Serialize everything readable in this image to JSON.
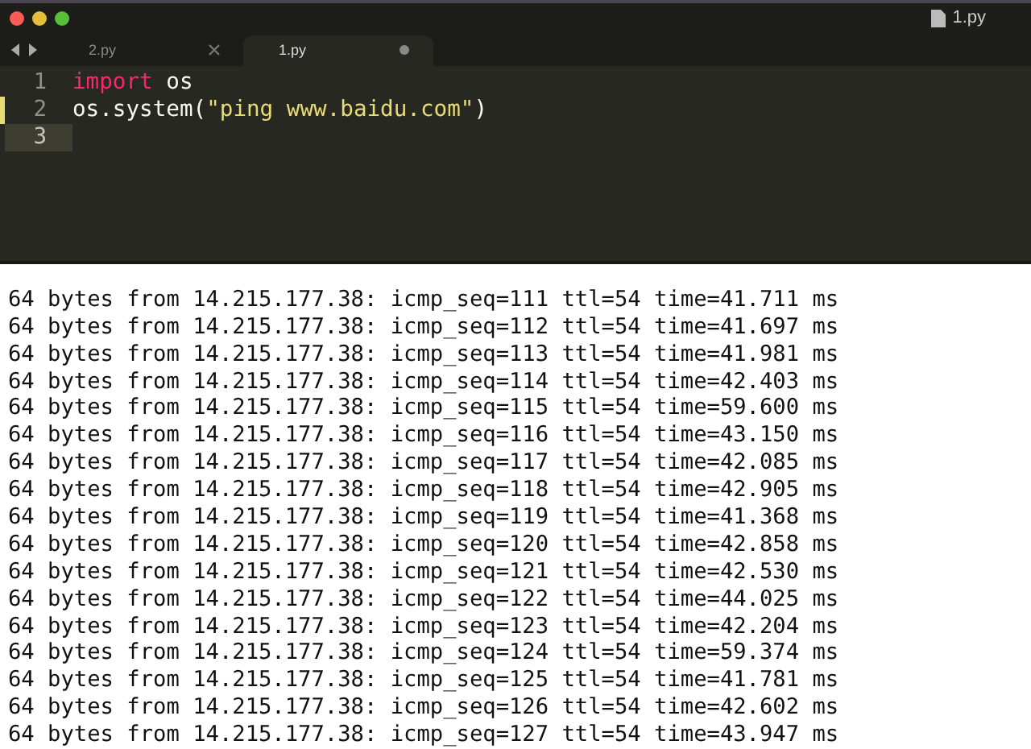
{
  "window": {
    "title": "1.py"
  },
  "tabs": [
    {
      "label": "2.py",
      "selected": false,
      "modified": false
    },
    {
      "label": "1.py",
      "selected": true,
      "modified": true
    }
  ],
  "editor": {
    "lines": [
      {
        "number": "1",
        "modified": false,
        "current": false,
        "tokens": [
          {
            "kind": "keyword",
            "text": "import"
          },
          {
            "kind": "plain",
            "text": " os"
          }
        ]
      },
      {
        "number": "2",
        "modified": true,
        "current": false,
        "tokens": [
          {
            "kind": "plain",
            "text": "os.system("
          },
          {
            "kind": "string",
            "text": "\"ping www.baidu.com\""
          },
          {
            "kind": "plain",
            "text": ")"
          }
        ]
      },
      {
        "number": "3",
        "modified": false,
        "current": true
      }
    ]
  },
  "terminal": {
    "lines": [
      "64 bytes from 14.215.177.38: icmp_seq=111 ttl=54 time=41.711 ms",
      "64 bytes from 14.215.177.38: icmp_seq=112 ttl=54 time=41.697 ms",
      "64 bytes from 14.215.177.38: icmp_seq=113 ttl=54 time=41.981 ms",
      "64 bytes from 14.215.177.38: icmp_seq=114 ttl=54 time=42.403 ms",
      "64 bytes from 14.215.177.38: icmp_seq=115 ttl=54 time=59.600 ms",
      "64 bytes from 14.215.177.38: icmp_seq=116 ttl=54 time=43.150 ms",
      "64 bytes from 14.215.177.38: icmp_seq=117 ttl=54 time=42.085 ms",
      "64 bytes from 14.215.177.38: icmp_seq=118 ttl=54 time=42.905 ms",
      "64 bytes from 14.215.177.38: icmp_seq=119 ttl=54 time=41.368 ms",
      "64 bytes from 14.215.177.38: icmp_seq=120 ttl=54 time=42.858 ms",
      "64 bytes from 14.215.177.38: icmp_seq=121 ttl=54 time=42.530 ms",
      "64 bytes from 14.215.177.38: icmp_seq=122 ttl=54 time=44.025 ms",
      "64 bytes from 14.215.177.38: icmp_seq=123 ttl=54 time=42.204 ms",
      "64 bytes from 14.215.177.38: icmp_seq=124 ttl=54 time=59.374 ms",
      "64 bytes from 14.215.177.38: icmp_seq=125 ttl=54 time=41.781 ms",
      "64 bytes from 14.215.177.38: icmp_seq=126 ttl=54 time=42.602 ms",
      "64 bytes from 14.215.177.38: icmp_seq=127 ttl=54 time=43.947 ms"
    ]
  }
}
